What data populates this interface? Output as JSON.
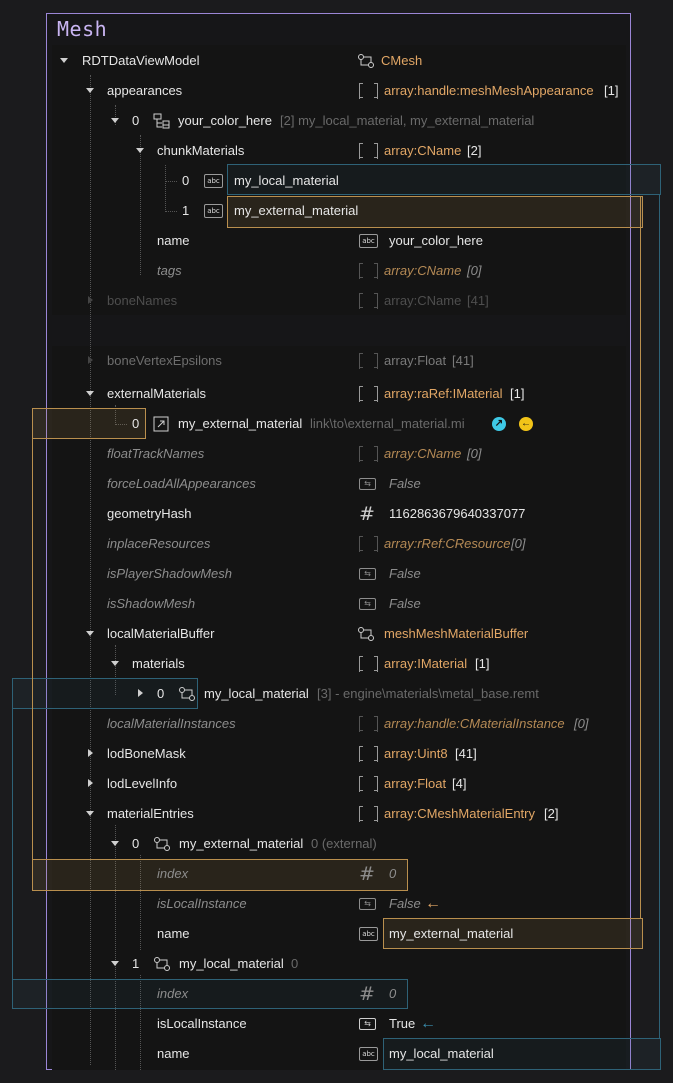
{
  "panel": {
    "title": "Mesh"
  },
  "root": {
    "name": "RDTDataViewModel",
    "type": "CMesh"
  },
  "appearances": {
    "name": "appearances",
    "type": "array:handle:meshMeshAppearance",
    "count": "[1]",
    "item0": {
      "index": "0",
      "name": "your_color_here",
      "summary": "[2] my_local_material, my_external_material"
    },
    "chunkMaterials": {
      "name": "chunkMaterials",
      "type": "array:CName",
      "count": "[2]"
    },
    "chunk0": {
      "index": "0",
      "value": "my_local_material"
    },
    "chunk1": {
      "index": "1",
      "value": "my_external_material"
    },
    "nameField": {
      "name": "name",
      "value": "your_color_here"
    },
    "tags": {
      "name": "tags",
      "type": "array:CName",
      "count": "[0]"
    }
  },
  "boneNames": {
    "name": "boneNames",
    "type": "array:CName",
    "count": "[41]"
  },
  "boneVertexEpsilons": {
    "name": "boneVertexEpsilons",
    "type": "array:Float",
    "count": "[41]"
  },
  "externalMaterials": {
    "name": "externalMaterials",
    "type": "array:raRef:IMaterial",
    "count": "[1]",
    "item0": {
      "index": "0",
      "name": "my_external_material",
      "path": "link\\to\\external_material.mi"
    }
  },
  "floatTrackNames": {
    "name": "floatTrackNames",
    "type": "array:CName",
    "count": "[0]"
  },
  "forceLoadAllAppearances": {
    "name": "forceLoadAllAppearances",
    "value": "False"
  },
  "geometryHash": {
    "name": "geometryHash",
    "value": "1162863679640337077"
  },
  "inplaceResources": {
    "name": "inplaceResources",
    "type": "array:rRef:CResource",
    "count": "[0]"
  },
  "isPlayerShadowMesh": {
    "name": "isPlayerShadowMesh",
    "value": "False"
  },
  "isShadowMesh": {
    "name": "isShadowMesh",
    "value": "False"
  },
  "localMaterialBuffer": {
    "name": "localMaterialBuffer",
    "type": "meshMeshMaterialBuffer",
    "materials": {
      "name": "materials",
      "type": "array:IMaterial",
      "count": "[1]"
    },
    "item0": {
      "index": "0",
      "name": "my_local_material",
      "summary": "[3] - engine\\materials\\metal_base.remt"
    }
  },
  "localMaterialInstances": {
    "name": "localMaterialInstances",
    "type": "array:handle:CMaterialInstance",
    "count": "[0]"
  },
  "lodBoneMask": {
    "name": "lodBoneMask",
    "type": "array:Uint8",
    "count": "[41]"
  },
  "lodLevelInfo": {
    "name": "lodLevelInfo",
    "type": "array:Float",
    "count": "[4]"
  },
  "materialEntries": {
    "name": "materialEntries",
    "type": "array:CMeshMaterialEntry",
    "count": "[2]",
    "entry0": {
      "index": "0",
      "name": "my_external_material",
      "summary": "0 (external)",
      "indexField": {
        "name": "index",
        "value": "0"
      },
      "isLocalInstance": {
        "name": "isLocalInstance",
        "value": "False"
      },
      "nameField": {
        "name": "name",
        "value": "my_external_material"
      }
    },
    "entry1": {
      "index": "1",
      "name": "my_local_material",
      "summary": "0",
      "indexField": {
        "name": "index",
        "value": "0"
      },
      "isLocalInstance": {
        "name": "isLocalInstance",
        "value": "True"
      },
      "nameField": {
        "name": "name",
        "value": "my_local_material"
      }
    }
  },
  "colors": {
    "accent_orange": "#e2a766",
    "highlight_blue": "#2e6277",
    "frame_purple": "#9b86d6",
    "link_cyan": "#3ec9e6",
    "link_yellow": "#f2c418"
  }
}
